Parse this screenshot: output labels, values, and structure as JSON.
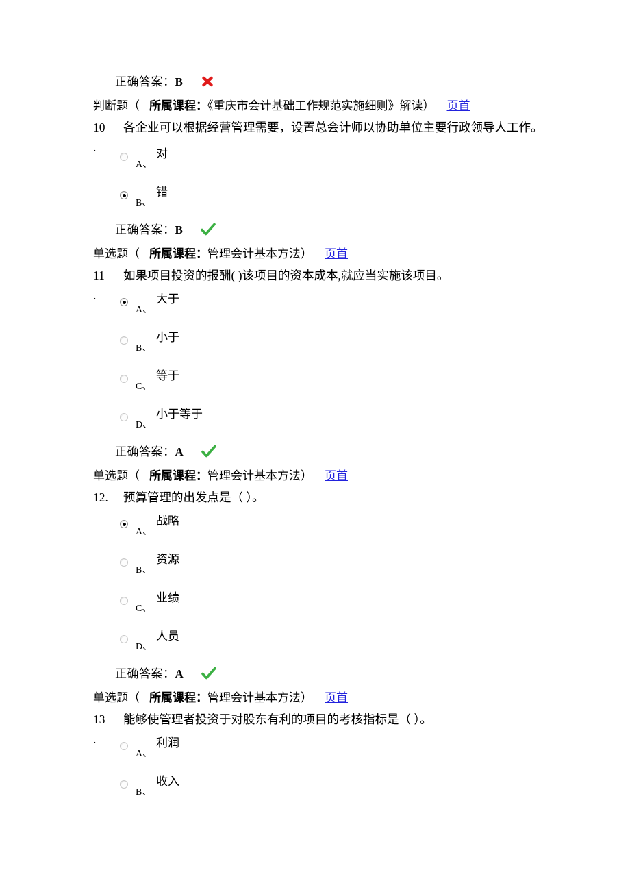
{
  "page": {
    "link_color": "#2222dd",
    "correct_mark_color": "#3cb043",
    "wrong_mark_color": "#e01b1b"
  },
  "labels": {
    "answer_prefix": "正确答案：",
    "course_label": "所属课程：",
    "top_link": "页首",
    "paren_open": "（",
    "paren_close": "）"
  },
  "leading_answer": {
    "prefix": "正确答案：",
    "letter": "B",
    "mark": "wrong-icon"
  },
  "blocks": [
    {
      "type_label": "判断题",
      "course": "《重庆市会计基础工作规范实施细则》解读",
      "top_link": "页首",
      "number": "10",
      "number_dot": ".",
      "number_inline": false,
      "stem": "各企业可以根据经营管理需要，设置总会计师以协助单位主要行政领导人工作。",
      "stem_wraps": true,
      "options": [
        {
          "letter": "A、",
          "text": "对",
          "checked": false
        },
        {
          "letter": "B、",
          "text": "错",
          "checked": true
        }
      ],
      "answer": {
        "prefix": "正确答案：",
        "letter": "B",
        "mark": "correct-icon"
      }
    },
    {
      "type_label": "单选题",
      "course": "管理会计基本方法",
      "top_link": "页首",
      "number": "11",
      "number_dot": ".",
      "number_inline": false,
      "stem": "如果项目投资的报酬(                )该项目的资本成本,就应当实施该项目。",
      "stem_wraps": false,
      "options": [
        {
          "letter": "A、",
          "text": "大于",
          "checked": true
        },
        {
          "letter": "B、",
          "text": "小于",
          "checked": false
        },
        {
          "letter": "C、",
          "text": "等于",
          "checked": false
        },
        {
          "letter": "D、",
          "text": "小于等于",
          "checked": false
        }
      ],
      "answer": {
        "prefix": "正确答案：",
        "letter": "A",
        "mark": "correct-icon"
      }
    },
    {
      "type_label": "单选题",
      "course": "管理会计基本方法",
      "top_link": "页首",
      "number": "12.",
      "number_dot": "",
      "number_inline": true,
      "stem": "预算管理的出发点是（ ）。",
      "stem_wraps": false,
      "options": [
        {
          "letter": "A、",
          "text": "战略",
          "checked": true
        },
        {
          "letter": "B、",
          "text": "资源",
          "checked": false
        },
        {
          "letter": "C、",
          "text": "业绩",
          "checked": false
        },
        {
          "letter": "D、",
          "text": "人员",
          "checked": false
        }
      ],
      "answer": {
        "prefix": "正确答案：",
        "letter": "A",
        "mark": "correct-icon"
      }
    },
    {
      "type_label": "单选题",
      "course": "管理会计基本方法",
      "top_link": "页首",
      "number": "13",
      "number_dot": ".",
      "number_inline": false,
      "stem": "能够使管理者投资于对股东有利的项目的考核指标是（ ）。",
      "stem_wraps": false,
      "options": [
        {
          "letter": "A、",
          "text": "利润",
          "checked": false
        },
        {
          "letter": "B、",
          "text": "收入",
          "checked": false
        }
      ],
      "answer": null
    }
  ]
}
